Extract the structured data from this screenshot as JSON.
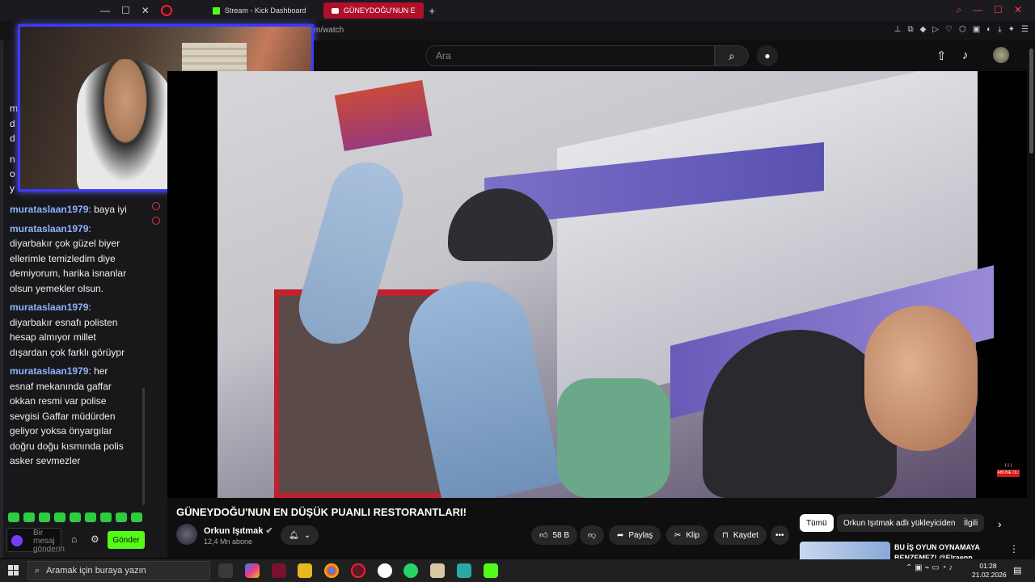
{
  "browser": {
    "tabs": [
      {
        "label": "Stream - Kick Dashboard",
        "active": false
      },
      {
        "label": "GÜNEYDOĞU'NUN EN",
        "active": true
      }
    ],
    "url_fragment": "m/watch"
  },
  "chat": {
    "fragments": [
      "m",
      "d",
      "d",
      "n",
      "o",
      "y"
    ],
    "messages": [
      {
        "user": "murataslaan1979",
        "text": "baya iyi"
      },
      {
        "user": "murataslaan1979",
        "text": "diyarbakır çok güzel biyer ellerimle temizledim diye demiyorum, harika isnanlar olsun yemekler olsun."
      },
      {
        "user": "murataslaan1979",
        "text": "diyarbakır esnafı polisten hesap almıyor millet dışardan çok farklı görüypr"
      },
      {
        "user": "murataslaan1979",
        "text": "her esnaf mekanında gaffar okkan resmi var polise sevgisi Gaffar müdürden geliyor yoksa önyargılar doğru doğu kısmında polis asker sevmezler"
      }
    ],
    "input_placeholder": "Bir mesaj gönderin",
    "send_label": "Gönder"
  },
  "youtube": {
    "search_placeholder": "Ara",
    "video_title": "GÜNEYDOĞU'NUN EN DÜŞÜK PUANLI RESTORANTLARI!",
    "channel_name": "Orkun Işıtmak",
    "subscribers": "12,4 Mn abone",
    "likes": "58 B",
    "share_label": "Paylaş",
    "clip_label": "Klip",
    "save_label": "Kaydet",
    "watermark_label": "ABONE OL!",
    "chips": [
      "Tümü",
      "Orkun Işıtmak adlı yükleyiciden",
      "İlgili"
    ],
    "recommended_title": "BU İŞ OYUN OYNAMAYA BENZEMEZ! @Elraenn YEMEK"
  },
  "taskbar": {
    "search_placeholder": "Aramak için buraya yazın",
    "time": "01:28",
    "date": "21.02.2026"
  },
  "colors": {
    "kick_green": "#53fc18",
    "active_tab": "#b0102a",
    "cam_border": "#3b3bff",
    "username": "#8fb1ff"
  }
}
